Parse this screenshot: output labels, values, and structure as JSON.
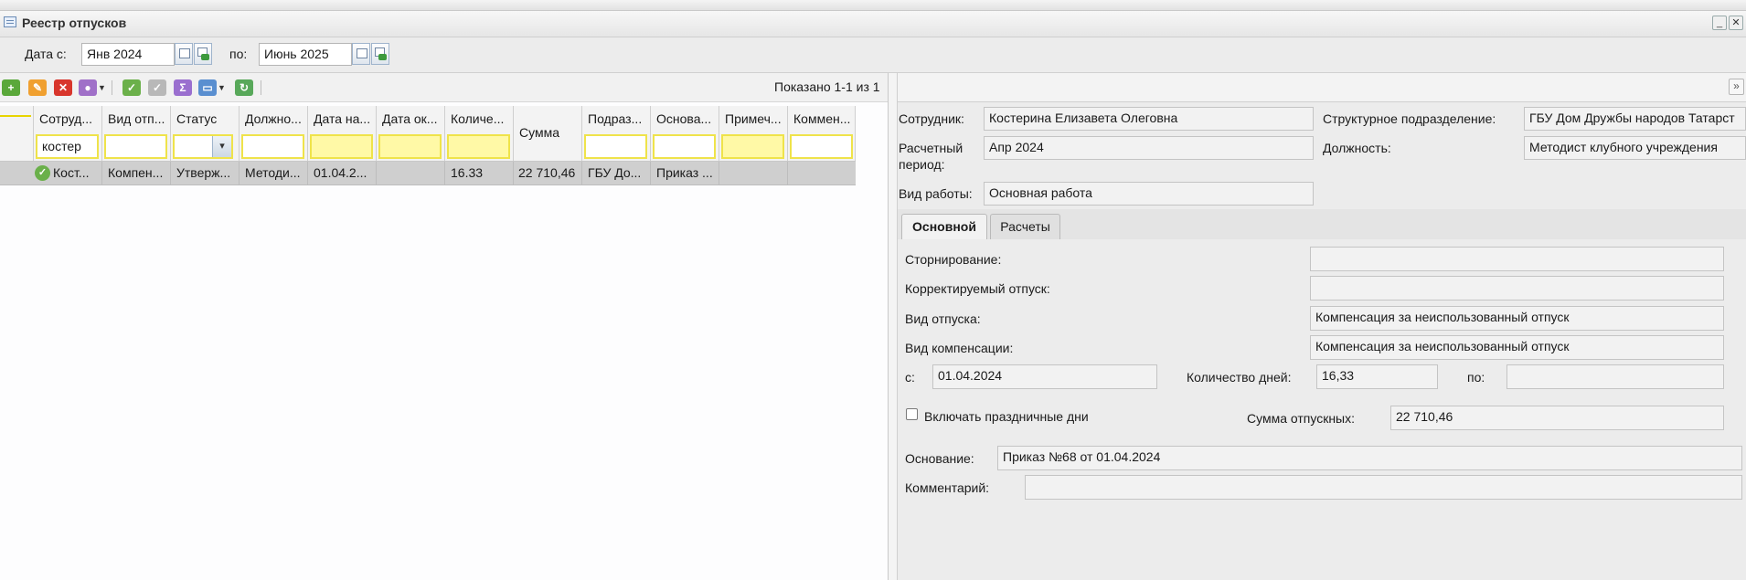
{
  "window": {
    "title": "Реестр отпусков"
  },
  "datebar": {
    "from_label": "Дата с:",
    "from_value": "Янв 2024",
    "to_label": "по:",
    "to_value": "Июнь 2025"
  },
  "toolbar": {
    "shown_text": "Показано 1-1 из 1"
  },
  "grid": {
    "columns": [
      "Сотруд...",
      "Вид отп...",
      "Статус",
      "Должно...",
      "Дата на...",
      "Дата ок...",
      "Количе...",
      "Сумма",
      "Подраз...",
      "Основа...",
      "Примеч...",
      "Коммен..."
    ],
    "filter_employee": "костер",
    "row": {
      "employee": "Кост...",
      "type": "Компен...",
      "status": "Утверж...",
      "position": "Методи...",
      "start": "01.04.2...",
      "end": "",
      "days": "16.33",
      "sum": "22 710,46",
      "dept": "ГБУ До...",
      "basis": "Приказ ...",
      "note": "",
      "comment": ""
    }
  },
  "detail": {
    "employee_label": "Сотрудник:",
    "employee_value": "Костерина Елизавета Олеговна",
    "dept_label": "Структурное подразделение:",
    "dept_value": "ГБУ Дом Дружбы народов Татарст",
    "period_label_1": "Расчетный",
    "period_label_2": "период:",
    "period_value": "Апр 2024",
    "position_label": "Должность:",
    "position_value": "Методист клубного учреждения",
    "worktype_label": "Вид работы:",
    "worktype_value": "Основная работа",
    "tabs": [
      "Основной",
      "Расчеты"
    ],
    "storno_label": "Сторнирование:",
    "storno_value": "",
    "corrected_label": "Корректируемый отпуск:",
    "corrected_value": "",
    "leave_type_label": "Вид отпуска:",
    "leave_type_value": "Компенсация за неиспользованный отпуск",
    "comp_type_label": "Вид компенсации:",
    "comp_type_value": "Компенсация за неиспользованный отпуск",
    "from_label": "с:",
    "from_value": "01.04.2024",
    "days_label": "Количество дней:",
    "days_value": "16,33",
    "to_label": "по:",
    "to_value": "",
    "holidays_label": "Включать праздничные дни",
    "sum_label": "Сумма отпускных:",
    "sum_value": "22 710,46",
    "basis_label": "Основание:",
    "basis_value": "Приказ №68 от 01.04.2024",
    "comment_label": "Комментарий:",
    "comment_value": ""
  }
}
